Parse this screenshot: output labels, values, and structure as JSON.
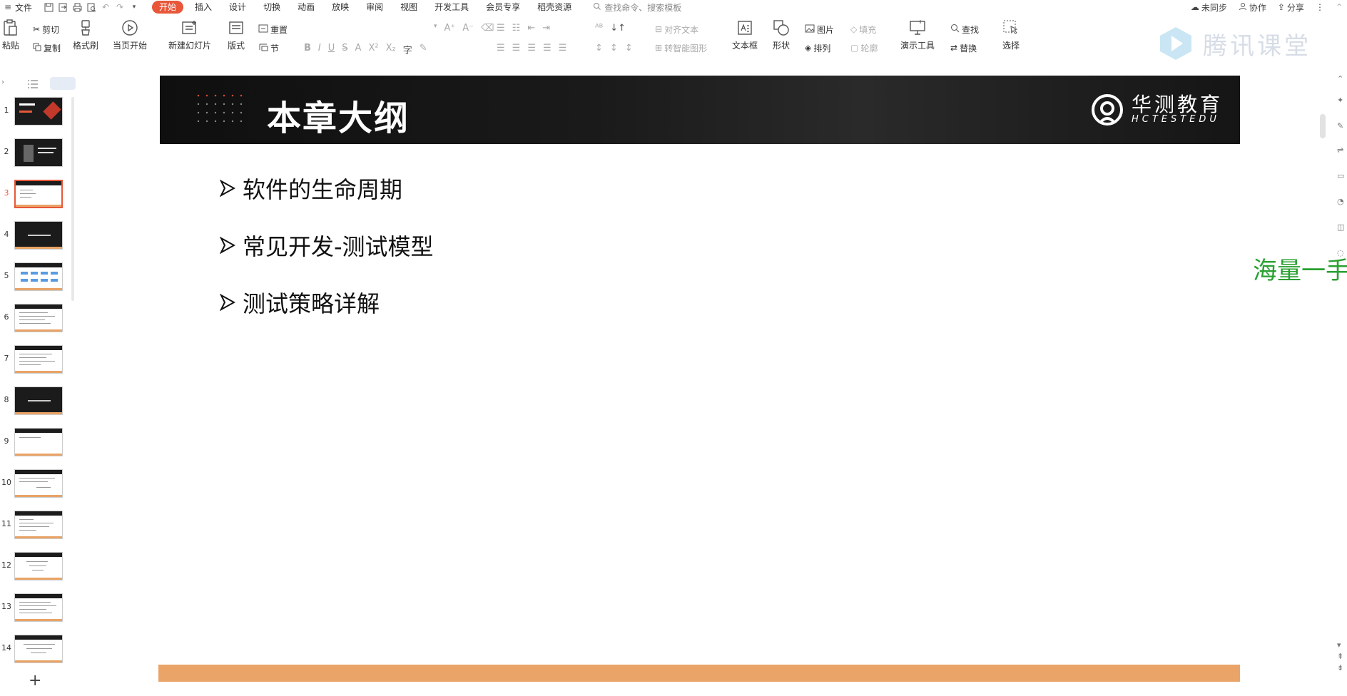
{
  "menubar": {
    "file_label": "文件",
    "tabs": [
      "开始",
      "插入",
      "设计",
      "切换",
      "动画",
      "放映",
      "审阅",
      "视图",
      "开发工具",
      "会员专享",
      "稻壳资源"
    ],
    "search_placeholder": "查找命令、搜索模板",
    "right": {
      "sync": "未同步",
      "collab": "协作",
      "share": "分享"
    }
  },
  "ribbon": {
    "paste": "粘贴",
    "cut": "剪切",
    "copy": "复制",
    "format_painter": "格式刷",
    "start_from_current": "当页开始",
    "new_slide": "新建幻灯片",
    "layout": "版式",
    "reset": "重置",
    "section": "节",
    "align_text": "对齐文本",
    "smart_shape": "转智能图形",
    "textbox": "文本框",
    "shape": "形状",
    "picture": "图片",
    "fill": "填充",
    "arrange": "排列",
    "outline": "轮廓",
    "present_tools": "演示工具",
    "find": "查找",
    "replace": "替换",
    "select": "选择"
  },
  "watermark": {
    "tencent": "腾讯课堂",
    "green": "海量一手"
  },
  "slides": {
    "numbers": [
      "1",
      "2",
      "3",
      "4",
      "5",
      "6",
      "7",
      "8",
      "9",
      "10",
      "11",
      "12",
      "13",
      "14"
    ],
    "active": "3"
  },
  "slide": {
    "title": "本章大纲",
    "brand_cn": "华测教育",
    "brand_en": "HCTESTEDU",
    "bullets": [
      "软件的生命周期",
      "常见开发-测试模型",
      "测试策略详解"
    ]
  },
  "colors": {
    "accent": "#e8573a",
    "footer": "#eba468",
    "header": "#111111",
    "watermark_green": "#2aa032"
  }
}
